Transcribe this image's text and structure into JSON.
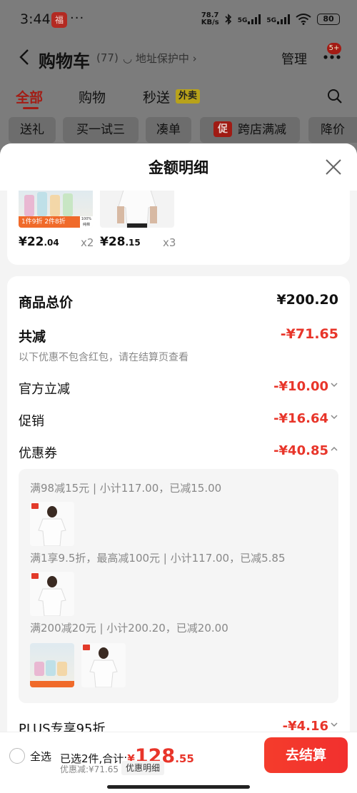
{
  "status_bar": {
    "time": "3:44",
    "app_icon_text": "福",
    "more": "···",
    "net_speed_top": "78.7",
    "net_speed_bottom": "KB/s",
    "sim1_label": "5G",
    "sim2_label": "5G",
    "battery": "80"
  },
  "nav": {
    "title": "购物车",
    "count": "(77)",
    "address_tag": "◡ 地址保护中 ›",
    "manage_label": "管理",
    "badge": "5+"
  },
  "tabs": [
    {
      "label": "全部",
      "active": true
    },
    {
      "label": "购物",
      "active": false
    },
    {
      "label": "秒送",
      "active": false
    }
  ],
  "tab_badge": "外卖",
  "chips": [
    "送礼",
    "买一试三",
    "凑单",
    "跨店满减",
    "降价"
  ],
  "chip_tag": "促",
  "sheet": {
    "title": "金额明细",
    "items": [
      {
        "price_int": "¥22",
        "price_dec": ".04",
        "qty": "x2",
        "promo": "1件9折 2件8折",
        "side": "100% 纯棉"
      },
      {
        "price_int": "¥28",
        "price_dec": ".15",
        "qty": "x3"
      }
    ],
    "rows": {
      "total_label": "商品总价",
      "total_value": "¥200.20",
      "reduce_label": "共减",
      "reduce_value": "-¥71.65",
      "reduce_note": "以下优惠不包含红包，请在结算页查看",
      "official_label": "官方立减",
      "official_value": "-¥10.00",
      "promo_label": "促销",
      "promo_value": "-¥16.64",
      "coupon_label": "优惠券",
      "coupon_value": "-¥40.85",
      "plus_label": "PLUS专享95折",
      "plus_value": "-¥4.16"
    },
    "coupon_lines": [
      "满98减15元 | 小计117.00，已减15.00",
      "满1享9.5折，最高减100元 | 小计117.00，已减5.85",
      "满200减20元 | 小计200.20，已减20.00"
    ]
  },
  "footer": {
    "select_all": "全选",
    "selected_text": "已选2件,合计:",
    "total_yen": "¥",
    "total_int": "128",
    "total_dec": ".55",
    "discount_text": "优惠减:¥71.65",
    "detail_btn": "优惠明细",
    "checkout": "去结算"
  },
  "colors": {
    "accent_red": "#e8352a",
    "checkout_red": "#f43c2c",
    "dim_overlay": "#7c7c7c"
  }
}
